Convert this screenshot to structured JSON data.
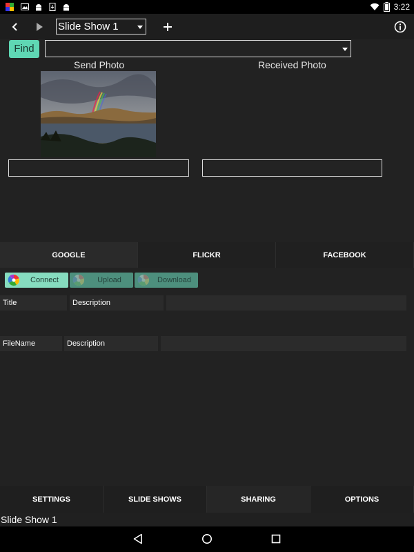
{
  "status_bar": {
    "time": "3:22",
    "battery_level": "x",
    "notification_icons": [
      "app-icon",
      "image-icon",
      "android-icon",
      "download-icon",
      "android-icon"
    ]
  },
  "toolbar": {
    "slideshow_select_value": "Slide Show 1"
  },
  "find": {
    "button_label": "Find",
    "input_value": ""
  },
  "columns": {
    "send_label": "Send Photo",
    "received_label": "Received Photo",
    "send_caption": "",
    "received_caption": ""
  },
  "service_tabs": [
    "GOOGLE",
    "FLICKR",
    "FACEBOOK"
  ],
  "service_buttons": {
    "connect": "Connect",
    "upload": "Upload",
    "download": "Download"
  },
  "upload_table": {
    "headers": [
      "Title",
      "Description"
    ]
  },
  "download_table": {
    "headers": [
      "FileName",
      "Description"
    ]
  },
  "bottom_tabs": [
    "SETTINGS",
    "SLIDE SHOWS",
    "SHARING",
    "OPTIONS"
  ],
  "active_bottom_tab": "SHARING",
  "status_line": "Slide Show 1",
  "colors": {
    "accent": "#5fd7b4",
    "accent_dim": "#3f8f7a",
    "background": "#222222"
  }
}
